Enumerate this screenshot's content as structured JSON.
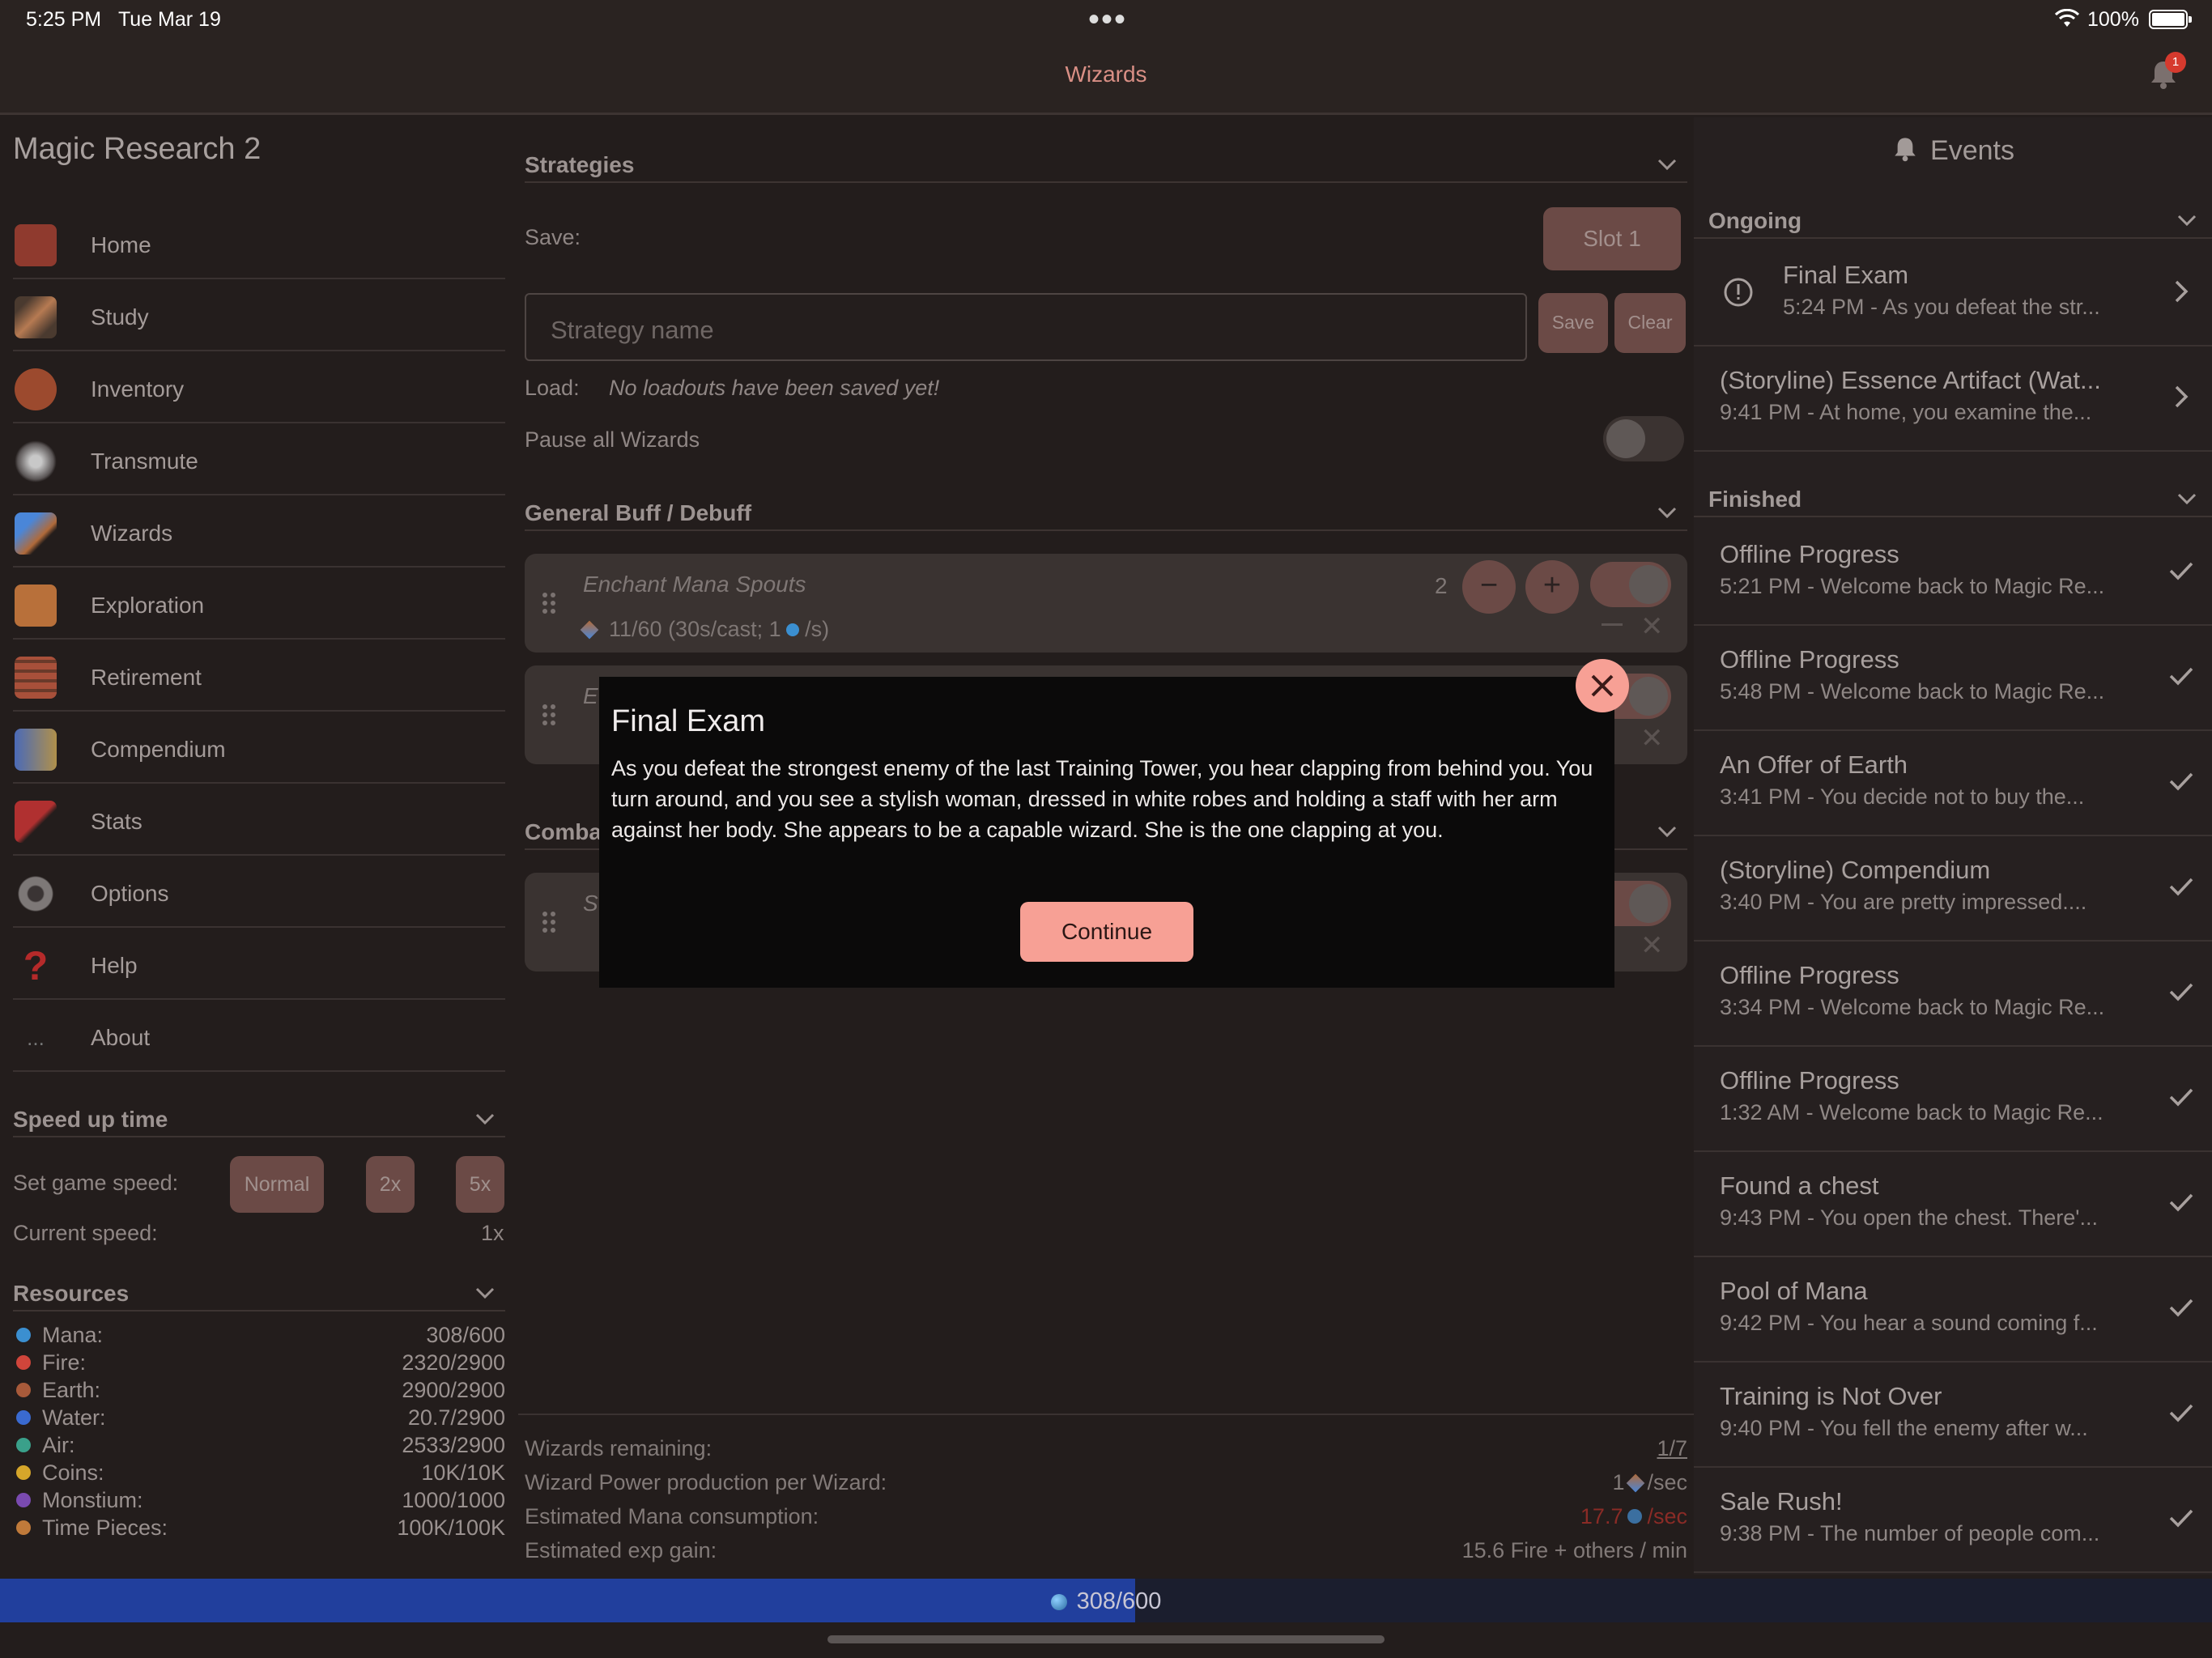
{
  "status_bar": {
    "time": "5:25 PM",
    "date": "Tue Mar 19",
    "battery": "100%"
  },
  "nav": {
    "title": "Wizards",
    "badge": "1"
  },
  "sidebar": {
    "app_title": "Magic Research 2",
    "items": [
      {
        "label": "Home",
        "icon": "home-icon",
        "color": "#a8362b"
      },
      {
        "label": "Study",
        "icon": "quill-icon",
        "color": "#8a5a3a"
      },
      {
        "label": "Inventory",
        "icon": "pot-icon",
        "color": "#b0502f"
      },
      {
        "label": "Transmute",
        "icon": "sparkle-icon",
        "color": "#b6b6b6"
      },
      {
        "label": "Wizards",
        "icon": "wand-icon",
        "color": "#4f7fc7"
      },
      {
        "label": "Exploration",
        "icon": "map-icon",
        "color": "#c8743a"
      },
      {
        "label": "Retirement",
        "icon": "bricks-icon",
        "color": "#b9583a"
      },
      {
        "label": "Compendium",
        "icon": "book-icon",
        "color": "#5a7ac8"
      },
      {
        "label": "Stats",
        "icon": "flag-icon",
        "color": "#c03a3a"
      },
      {
        "label": "Options",
        "icon": "gear-icon",
        "color": "#8f8f8f"
      },
      {
        "label": "Help",
        "icon": "question-icon",
        "color": "#c23232"
      },
      {
        "label": "About",
        "icon": "ellipsis-icon",
        "color": "#666666"
      }
    ],
    "speed": {
      "header": "Speed up time",
      "set_label": "Set game speed:",
      "buttons": [
        "Normal",
        "2x",
        "5x"
      ],
      "current_label": "Current speed:",
      "current_value": "1x"
    },
    "resources": {
      "header": "Resources",
      "items": [
        {
          "name": "Mana:",
          "value": "308/600",
          "color": "#3b8fd0"
        },
        {
          "name": "Fire:",
          "value": "2320/2900",
          "color": "#d0453b"
        },
        {
          "name": "Earth:",
          "value": "2900/2900",
          "color": "#a85a3a"
        },
        {
          "name": "Water:",
          "value": "20.7/2900",
          "color": "#3a6ad0"
        },
        {
          "name": "Air:",
          "value": "2533/2900",
          "color": "#3aa08a"
        },
        {
          "name": "Coins:",
          "value": "10K/10K",
          "color": "#d6a62a"
        },
        {
          "name": "Monstium:",
          "value": "1000/1000",
          "color": "#7a4ab0"
        },
        {
          "name": "Time Pieces:",
          "value": "100K/100K",
          "color": "#c07a3a"
        }
      ]
    }
  },
  "main": {
    "strategies": {
      "header": "Strategies",
      "save_label": "Save:",
      "slot_button": "Slot 1",
      "input_placeholder": "Strategy name",
      "save_button": "Save",
      "clear_button": "Clear",
      "load_label": "Load:",
      "load_value": "No loadouts have been saved yet!",
      "pause_label": "Pause all Wizards"
    },
    "buff": {
      "header": "General Buff / Debuff",
      "card1_title": "Enchant Mana Spouts",
      "card1_count": "2",
      "card1_detail": "11/60  (30s/cast; 1",
      "card1_detail_end": " /s)",
      "card2_title": "E"
    },
    "combat": {
      "header": "Comba",
      "card_title": "S"
    },
    "footer": [
      {
        "label": "Wizards remaining:",
        "value": "1/7"
      },
      {
        "label": "Wizard Power production per Wizard:",
        "value": "1",
        "unit": "/sec"
      },
      {
        "label": "Estimated Mana consumption:",
        "value": "17.7",
        "unit": "/sec"
      },
      {
        "label": "Estimated exp gain:",
        "value": "15.6 Fire + others / min"
      }
    ]
  },
  "events": {
    "title": "Events",
    "ongoing_header": "Ongoing",
    "finished_header": "Finished",
    "ongoing": [
      {
        "title": "Final Exam",
        "subtitle": "5:24 PM - As you defeat the str..."
      },
      {
        "title": "(Storyline) Essence Artifact (Wat...",
        "subtitle": "9:41 PM - At home, you examine the..."
      }
    ],
    "finished": [
      {
        "title": "Offline Progress",
        "subtitle": "5:21 PM - Welcome back to Magic Re..."
      },
      {
        "title": "Offline Progress",
        "subtitle": "5:48 PM - Welcome back to Magic Re..."
      },
      {
        "title": "An Offer of Earth",
        "subtitle": "3:41 PM - You decide not to buy the..."
      },
      {
        "title": "(Storyline) Compendium",
        "subtitle": "3:40 PM - You are pretty impressed...."
      },
      {
        "title": "Offline Progress",
        "subtitle": "3:34 PM - Welcome back to Magic Re..."
      },
      {
        "title": "Offline Progress",
        "subtitle": "1:32 AM - Welcome back to Magic Re..."
      },
      {
        "title": "Found a chest",
        "subtitle": "9:43 PM - You open the chest. There'..."
      },
      {
        "title": "Pool of Mana",
        "subtitle": "9:42 PM - You hear a sound coming f..."
      },
      {
        "title": "Training is Not Over",
        "subtitle": "9:40 PM - You fell the enemy after w..."
      },
      {
        "title": "Sale Rush!",
        "subtitle": "9:38 PM - The number of people com..."
      }
    ]
  },
  "mana_bar": {
    "label": "308/600",
    "fraction": 0.513
  },
  "modal": {
    "title": "Final Exam",
    "body": "As you defeat the strongest enemy of the last Training Tower, you hear clapping from behind you. You turn around, and you see a stylish woman, dressed in white robes and holding a staff with her arm against her body. She appears to be a capable wizard. She is the one clapping at you.",
    "continue": "Continue"
  }
}
